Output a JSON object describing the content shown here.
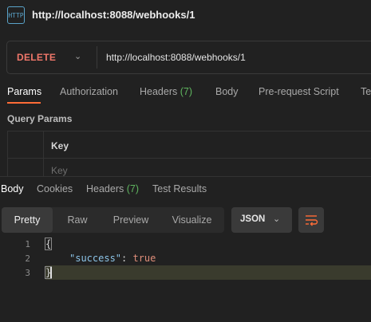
{
  "request": {
    "icon_text": "HTTP",
    "title": "http://localhost:8088/webhooks/1",
    "method": "DELETE",
    "url": "http://localhost:8088/webhooks/1"
  },
  "request_tabs": [
    {
      "label": "Params",
      "count": "",
      "active": true
    },
    {
      "label": "Authorization",
      "count": ""
    },
    {
      "label": "Headers",
      "count": "(7)"
    },
    {
      "label": "Body",
      "count": ""
    },
    {
      "label": "Pre-request Script",
      "count": ""
    },
    {
      "label": "Te",
      "count": ""
    }
  ],
  "query_params": {
    "label": "Query Params",
    "key_header": "Key",
    "key_placeholder": "Key"
  },
  "response_tabs": [
    {
      "label": "Body",
      "count": "",
      "active": true
    },
    {
      "label": "Cookies",
      "count": ""
    },
    {
      "label": "Headers",
      "count": "(7)"
    },
    {
      "label": "Test Results",
      "count": ""
    }
  ],
  "view_modes": [
    "Pretty",
    "Raw",
    "Preview",
    "Visualize"
  ],
  "active_view": "Pretty",
  "format": "JSON",
  "code": {
    "line_numbers": [
      "1",
      "2",
      "3"
    ],
    "open_brace": "{",
    "key": "\"success\"",
    "colon": ": ",
    "value": "true",
    "close_brace": "}"
  },
  "colors": {
    "accent": "#ff6c37",
    "method_delete": "#f0776a",
    "count_green": "#5fb55f",
    "json_key": "#8cc4e8",
    "json_value": "#e08e7a"
  }
}
